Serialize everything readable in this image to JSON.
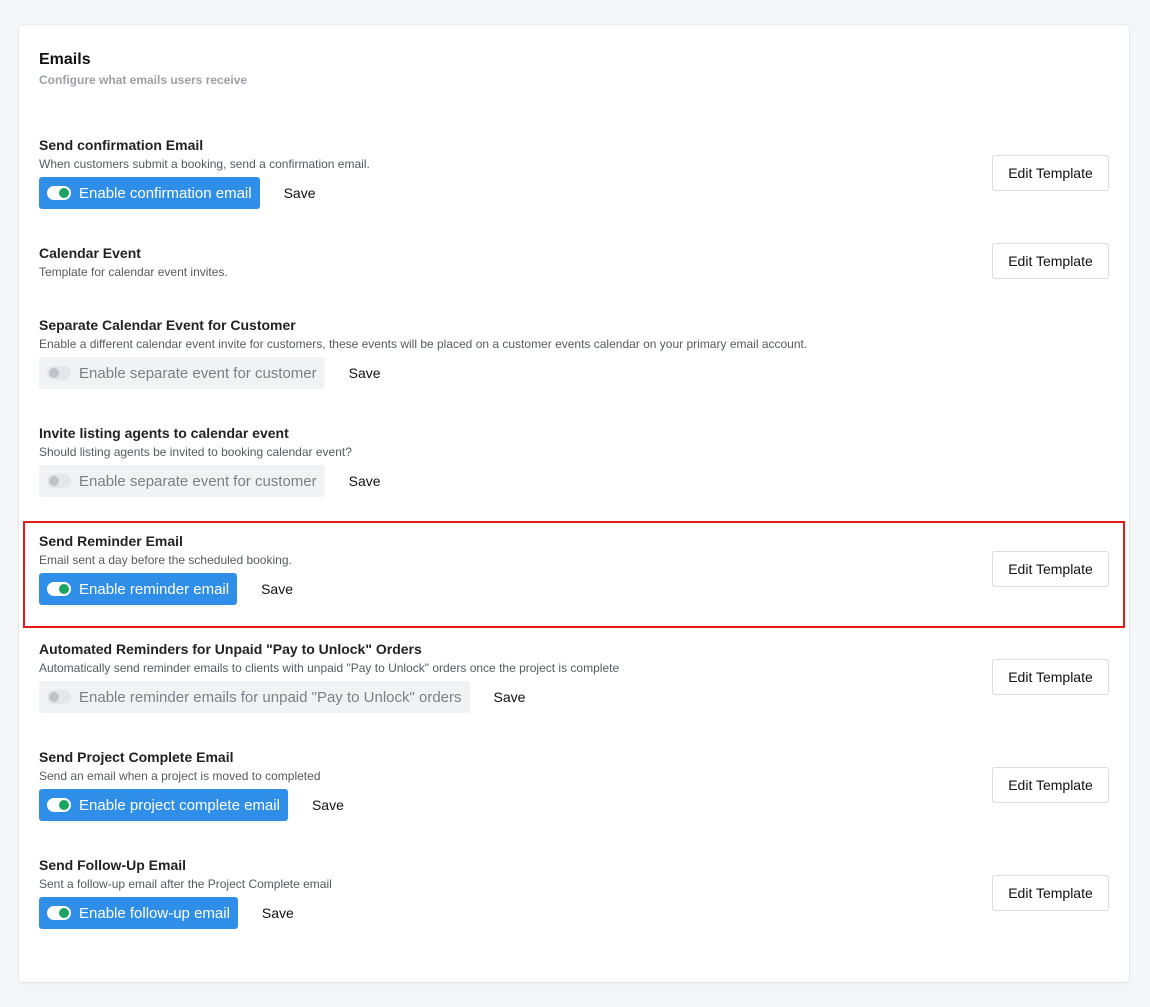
{
  "header": {
    "title": "Emails",
    "subtitle": "Configure what emails users receive"
  },
  "sections": [
    {
      "title": "Send confirmation Email",
      "description": "When customers submit a booking, send a confirmation email.",
      "toggle_label": "Enable confirmation email",
      "toggle_on": true,
      "save_label": "Save",
      "edit_label": "Edit Template"
    },
    {
      "title": "Calendar Event",
      "description": "Template for calendar event invites.",
      "edit_label": "Edit Template"
    },
    {
      "title": "Separate Calendar Event for Customer",
      "description": "Enable a different calendar event invite for customers, these events will be placed on a customer events calendar on your primary email account.",
      "toggle_label": "Enable separate event for customer",
      "toggle_on": false,
      "save_label": "Save"
    },
    {
      "title": "Invite listing agents to calendar event",
      "description": "Should listing agents be invited to booking calendar event?",
      "toggle_label": "Enable separate event for customer",
      "toggle_on": false,
      "save_label": "Save"
    },
    {
      "title": "Send Reminder Email",
      "description": "Email sent a day before the scheduled booking.",
      "toggle_label": "Enable reminder email",
      "toggle_on": true,
      "save_label": "Save",
      "edit_label": "Edit Template"
    },
    {
      "title": "Automated Reminders for Unpaid \"Pay to Unlock\" Orders",
      "description": "Automatically send reminder emails to clients with unpaid \"Pay to Unlock\" orders once the project is complete",
      "toggle_label": "Enable reminder emails for unpaid \"Pay to Unlock\" orders",
      "toggle_on": false,
      "save_label": "Save",
      "edit_label": "Edit Template"
    },
    {
      "title": "Send Project Complete Email",
      "description": "Send an email when a project is moved to completed",
      "toggle_label": "Enable project complete email",
      "toggle_on": true,
      "save_label": "Save",
      "edit_label": "Edit Template"
    },
    {
      "title": "Send Follow-Up Email",
      "description": "Sent a follow-up email after the Project Complete email",
      "toggle_label": "Enable follow-up email",
      "toggle_on": true,
      "save_label": "Save",
      "edit_label": "Edit Template"
    }
  ],
  "colors": {
    "toggle_on_bg": "#2f8fe8",
    "toggle_knob_on": "#1aa464",
    "highlight": "#e81919"
  }
}
